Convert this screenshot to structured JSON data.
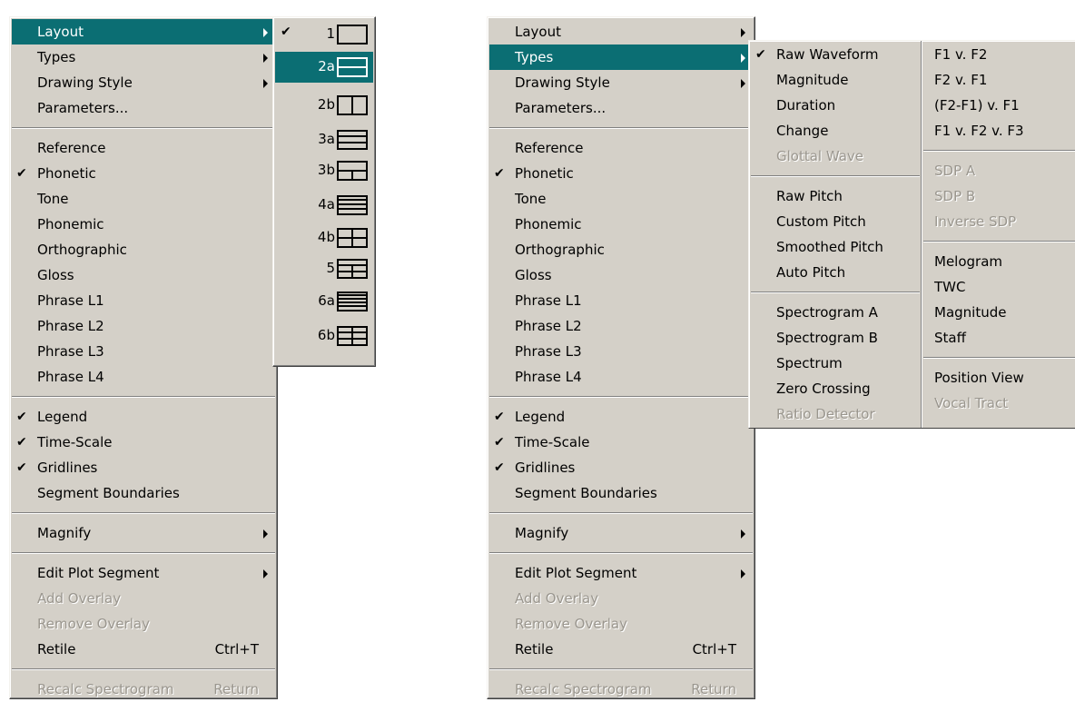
{
  "main_menu": {
    "items": [
      {
        "label": "Layout",
        "submenu": true
      },
      {
        "label": "Types",
        "submenu": true
      },
      {
        "label": "Drawing Style",
        "submenu": true
      },
      {
        "label": "Parameters..."
      },
      {
        "label": "Reference"
      },
      {
        "label": "Phonetic",
        "checked": true
      },
      {
        "label": "Tone"
      },
      {
        "label": "Phonemic"
      },
      {
        "label": "Orthographic"
      },
      {
        "label": "Gloss"
      },
      {
        "label": "Phrase L1"
      },
      {
        "label": "Phrase L2"
      },
      {
        "label": "Phrase L3"
      },
      {
        "label": "Phrase L4"
      },
      {
        "label": "Legend",
        "checked": true
      },
      {
        "label": "Time-Scale",
        "checked": true
      },
      {
        "label": "Gridlines",
        "checked": true
      },
      {
        "label": "Segment Boundaries"
      },
      {
        "label": "Magnify",
        "submenu": true
      },
      {
        "label": "Edit Plot Segment",
        "submenu": true
      },
      {
        "label": "Add Overlay",
        "disabled": true
      },
      {
        "label": "Remove Overlay",
        "disabled": true
      },
      {
        "label": "Retile",
        "shortcut": "Ctrl+T"
      },
      {
        "label": "Recalc Spectrogram",
        "shortcut": "Return",
        "disabled": true
      }
    ],
    "check_glyph": "✔"
  },
  "layout_submenu": {
    "items": [
      {
        "label": "1",
        "checked": true,
        "icon": "layout-single"
      },
      {
        "label": "2a",
        "icon": "layout-2-rows",
        "highlighted": true
      },
      {
        "label": "2b",
        "icon": "layout-2-cols"
      },
      {
        "label": "3a",
        "icon": "layout-3-rows"
      },
      {
        "label": "3b",
        "icon": "layout-1-top-2-bottom"
      },
      {
        "label": "4a",
        "icon": "layout-4-rows"
      },
      {
        "label": "4b",
        "icon": "layout-2x2"
      },
      {
        "label": "5",
        "icon": "layout-1-top-2x2"
      },
      {
        "label": "6a",
        "icon": "layout-6-rows"
      },
      {
        "label": "6b",
        "icon": "layout-3x2"
      }
    ]
  },
  "types_submenu": {
    "col1": [
      {
        "label": "Raw Waveform",
        "checked": true
      },
      {
        "label": "Magnitude"
      },
      {
        "label": "Duration"
      },
      {
        "label": "Change"
      },
      {
        "label": "Glottal Wave",
        "disabled": true
      },
      {
        "label": "Raw Pitch"
      },
      {
        "label": "Custom Pitch"
      },
      {
        "label": "Smoothed Pitch"
      },
      {
        "label": "Auto Pitch"
      },
      {
        "label": "Spectrogram A"
      },
      {
        "label": "Spectrogram B"
      },
      {
        "label": "Spectrum"
      },
      {
        "label": "Zero Crossing"
      },
      {
        "label": "Ratio Detector",
        "disabled": true
      }
    ],
    "col2": [
      {
        "label": "F1 v. F2"
      },
      {
        "label": "F2 v. F1"
      },
      {
        "label": "(F2-F1) v. F1"
      },
      {
        "label": "F1 v. F2 v. F3"
      },
      {
        "label": "SDP A",
        "disabled": true
      },
      {
        "label": "SDP B",
        "disabled": true
      },
      {
        "label": "Inverse SDP",
        "disabled": true
      },
      {
        "label": "Melogram"
      },
      {
        "label": "TWC"
      },
      {
        "label": "Magnitude"
      },
      {
        "label": "Staff"
      },
      {
        "label": "Position View"
      },
      {
        "label": "Vocal Tract",
        "disabled": true
      }
    ]
  }
}
